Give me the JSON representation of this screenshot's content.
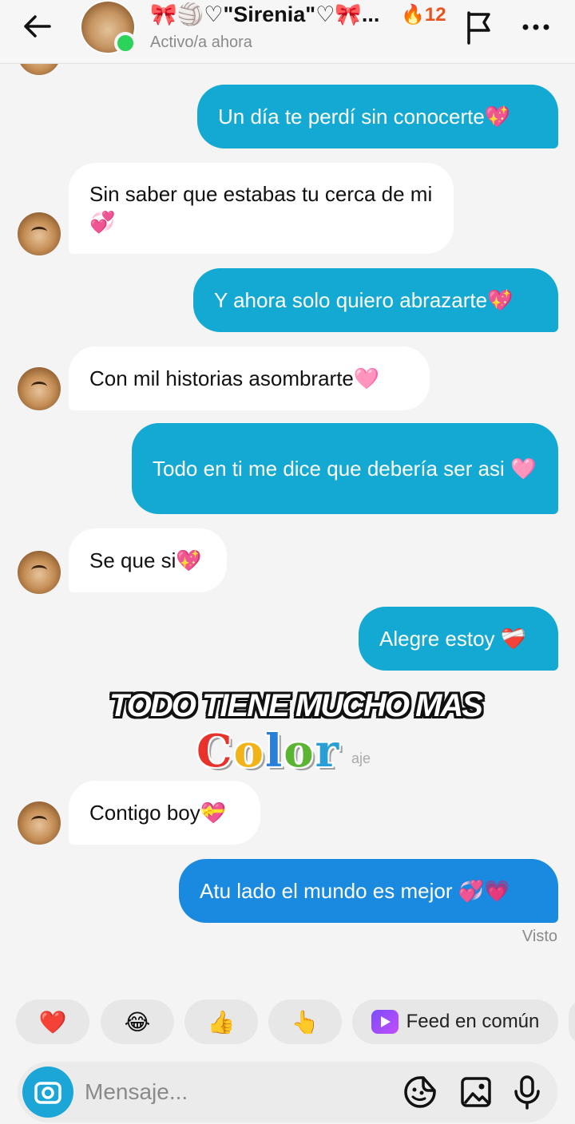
{
  "header": {
    "contact_name": "🎀🏐♡\"Sirenia\"♡🎀...",
    "status": "Activo/a ahora",
    "streak": "🔥12"
  },
  "messages": [
    {
      "side": "sent",
      "text": "Un día te perdí sin conocerte💖"
    },
    {
      "side": "received",
      "text": "Sin saber que estabas tu cerca de mi💞"
    },
    {
      "side": "sent",
      "text": "Y ahora solo quiero abrazarte💖"
    },
    {
      "side": "received",
      "text": "Con mil historias asombrarte🩷"
    },
    {
      "side": "sent",
      "text": "Todo en ti me dice que debería ser asi 🩷"
    },
    {
      "side": "received",
      "text": "Se que si💖"
    },
    {
      "side": "sent",
      "text": "Alegre estoy ❤️‍🩹"
    },
    {
      "side": "received",
      "text": "Contigo boy💝"
    },
    {
      "side": "sent",
      "text": "Atu lado el mundo es mejor 💞💗"
    }
  ],
  "overlay": {
    "line1": "TODO TIENE MUCHO MAS",
    "color_letters": [
      {
        "char": "C",
        "color": "#e8322b"
      },
      {
        "char": "o",
        "color": "#f2b318"
      },
      {
        "char": "l",
        "color": "#2a7fd6"
      },
      {
        "char": "o",
        "color": "#5bb533"
      },
      {
        "char": "r",
        "color": "#2a9fd6"
      }
    ],
    "hidden_tip": "aje"
  },
  "seen_label": "Visto",
  "quick_reactions": {
    "heart": "❤️",
    "laugh": "😂",
    "thumbs_up": "👍",
    "point": "👆",
    "feed_label": "Feed en común"
  },
  "composer": {
    "placeholder": "Mensaje..."
  },
  "colors": {
    "sent_bubble": "#13a9d3",
    "sent_bubble_last": "#1a8ae0",
    "received_bubble": "#ffffff",
    "online_dot": "#2bd35a",
    "camera_button": "#1ca6d8"
  }
}
